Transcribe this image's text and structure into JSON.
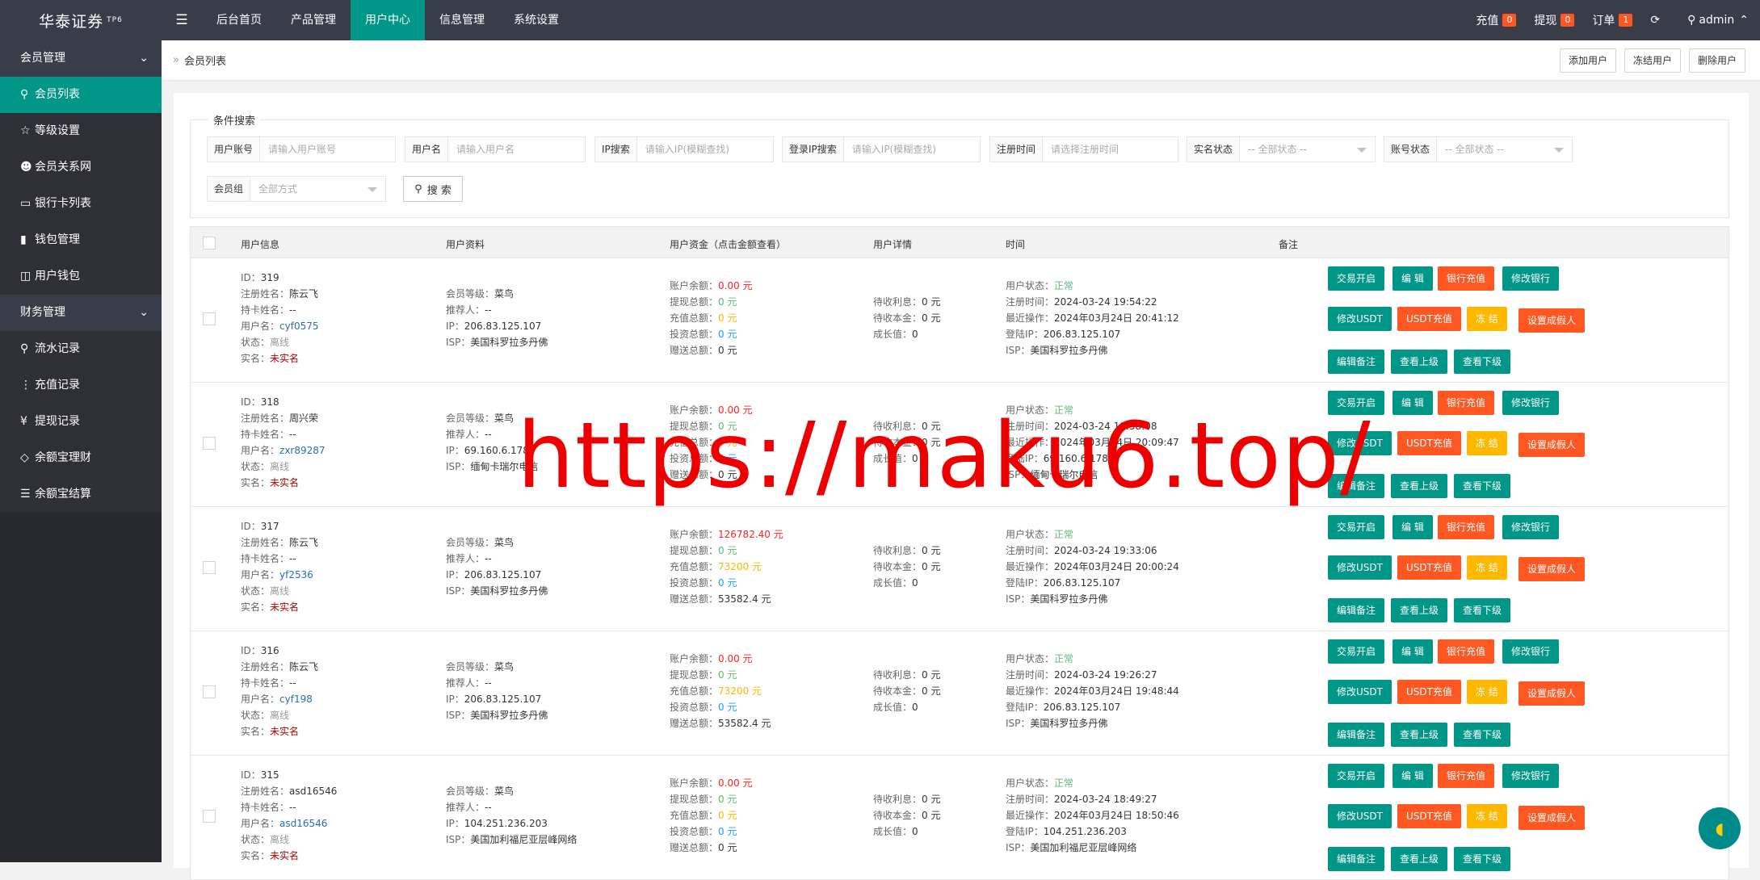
{
  "app": {
    "logo": "华泰证券",
    "logo_sup": "TP6"
  },
  "topnav": [
    "后台首页",
    "产品管理",
    "用户中心",
    "信息管理",
    "系统设置"
  ],
  "topright": {
    "recharge": "充值",
    "recharge_count": "0",
    "withdraw": "提现",
    "withdraw_count": "0",
    "orders": "订单",
    "orders_count": "1",
    "user": "admin"
  },
  "sidebar": {
    "group1": "会员管理",
    "items1": [
      {
        "label": "会员列表",
        "icon": "user-icon"
      },
      {
        "label": "等级设置",
        "icon": "star-icon"
      },
      {
        "label": "会员关系网",
        "icon": "users-icon"
      },
      {
        "label": "银行卡列表",
        "icon": "card-icon"
      },
      {
        "label": "钱包管理",
        "icon": "wallet-icon"
      },
      {
        "label": "用户钱包",
        "icon": "book-icon"
      }
    ],
    "group2": "财务管理",
    "items2": [
      {
        "label": "流水记录",
        "icon": "user-icon"
      },
      {
        "label": "充值记录",
        "icon": "dots-icon"
      },
      {
        "label": "提现记录",
        "icon": "yen-icon"
      },
      {
        "label": "余额宝理财",
        "icon": "diamond-icon"
      },
      {
        "label": "余额宝结算",
        "icon": "list-icon"
      }
    ]
  },
  "breadcrumb": "会员列表",
  "header_buttons": [
    "添加用户",
    "冻结用户",
    "删除用户"
  ],
  "filter": {
    "legend": "条件搜索",
    "fields": [
      {
        "label": "用户账号",
        "placeholder": "请输入用户账号"
      },
      {
        "label": "用户名",
        "placeholder": "请输入用户名"
      },
      {
        "label": "IP搜索",
        "placeholder": "请输入IP(模糊查找)"
      },
      {
        "label": "登录IP搜索",
        "placeholder": "请输入IP(模糊查找)"
      },
      {
        "label": "注册时间",
        "placeholder": "请选择注册时间"
      },
      {
        "label": "实名状态",
        "placeholder": "-- 全部状态 --"
      },
      {
        "label": "账号状态",
        "placeholder": "-- 全部状态 --"
      },
      {
        "label": "会员组",
        "placeholder": "全部方式"
      }
    ],
    "search": "搜 索"
  },
  "table": {
    "headers": [
      "用户信息",
      "用户资料",
      "用户资金（点击金额查看）",
      "用户详情",
      "时间",
      "备注"
    ]
  },
  "labels": {
    "id": "ID：",
    "realname": "注册姓名：",
    "cardholder": "持卡姓名：",
    "username": "用户名：",
    "status": "状态：",
    "verify": "实名：",
    "level": "会员等级：",
    "referrer": "推荐人：",
    "ip": "IP：",
    "isp": "ISP：",
    "balance": "账户余额：",
    "withdraw_total": "提现总额：",
    "recharge_total": "充值总额：",
    "invest_total": "投资总额：",
    "gift_total": "赠送总额：",
    "interest": "待收利息：",
    "principal": "待收本金：",
    "growth": "成长值：",
    "ustatus": "用户状态：",
    "regtime": "注册时间：",
    "lastop": "最近操作：",
    "loginip": "登陆IP：",
    "isp2": "ISP："
  },
  "buttons": [
    "交易开启",
    "编 辑",
    "银行充值",
    "修改银行",
    "修改USDT",
    "USDT充值",
    "冻 结",
    "设置成假人",
    "编辑备注",
    "查看上级",
    "查看下级"
  ],
  "rows": [
    {
      "id": "319",
      "realname": "陈云飞",
      "cardholder": "--",
      "username": "cyf0575",
      "status": "离线",
      "verify": "未实名",
      "level": "菜鸟",
      "referrer": "--",
      "ip": "206.83.125.107",
      "isp": "美国科罗拉多丹佛",
      "balance": "0.00 元",
      "withdraw": "0 元",
      "recharge": "0 元",
      "invest": "0 元",
      "gift": "0 元",
      "interest": "0 元",
      "principal": "0 元",
      "growth": "0",
      "ustatus": "正常",
      "regtime": "2024-03-24 19:54:22",
      "lastop": "2024年03月24日 20:41:12",
      "loginip": "206.83.125.107",
      "isp2": "美国科罗拉多丹佛"
    },
    {
      "id": "318",
      "realname": "周兴荣",
      "cardholder": "--",
      "username": "zxr89287",
      "status": "离线",
      "verify": "未实名",
      "level": "菜鸟",
      "referrer": "--",
      "ip": "69.160.6.178",
      "isp": "缅甸卡瑞尔电信",
      "balance": "0.00 元",
      "withdraw": "0 元",
      "recharge": "0 元",
      "invest": "0 元",
      "gift": "0 元",
      "interest": "0 元",
      "principal": "0 元",
      "growth": "0",
      "ustatus": "正常",
      "regtime": "2024-03-24 19:38:08",
      "lastop": "2024年03月24日 20:09:47",
      "loginip": "69.160.6.178",
      "isp2": "缅甸卡瑞尔电信"
    },
    {
      "id": "317",
      "realname": "陈云飞",
      "cardholder": "--",
      "username": "yf2536",
      "status": "离线",
      "verify": "未实名",
      "level": "菜鸟",
      "referrer": "--",
      "ip": "206.83.125.107",
      "isp": "美国科罗拉多丹佛",
      "balance": "126782.40 元",
      "withdraw": "0 元",
      "recharge": "73200 元",
      "invest": "0 元",
      "gift": "53582.4 元",
      "interest": "0 元",
      "principal": "0 元",
      "growth": "0",
      "ustatus": "正常",
      "regtime": "2024-03-24 19:33:06",
      "lastop": "2024年03月24日 20:00:24",
      "loginip": "206.83.125.107",
      "isp2": "美国科罗拉多丹佛"
    },
    {
      "id": "316",
      "realname": "陈云飞",
      "cardholder": "--",
      "username": "cyf198",
      "status": "离线",
      "verify": "未实名",
      "level": "菜鸟",
      "referrer": "--",
      "ip": "206.83.125.107",
      "isp": "美国科罗拉多丹佛",
      "balance": "0.00 元",
      "withdraw": "0 元",
      "recharge": "73200 元",
      "invest": "0 元",
      "gift": "53582.4 元",
      "interest": "0 元",
      "principal": "0 元",
      "growth": "0",
      "ustatus": "正常",
      "regtime": "2024-03-24 19:26:27",
      "lastop": "2024年03月24日 19:48:44",
      "loginip": "206.83.125.107",
      "isp2": "美国科罗拉多丹佛"
    },
    {
      "id": "315",
      "realname": "asd16546",
      "cardholder": "--",
      "username": "asd16546",
      "status": "离线",
      "verify": "未实名",
      "level": "菜鸟",
      "referrer": "--",
      "ip": "104.251.236.203",
      "isp": "美国加利福尼亚层峰网络",
      "balance": "0.00 元",
      "withdraw": "0 元",
      "recharge": "0 元",
      "invest": "0 元",
      "gift": "0 元",
      "interest": "0 元",
      "principal": "0 元",
      "growth": "0",
      "ustatus": "正常",
      "regtime": "2024-03-24 18:49:27",
      "lastop": "2024年03月24日 18:50:46",
      "loginip": "104.251.236.203",
      "isp2": "美国加利福尼亚层峰网络"
    }
  ],
  "watermark": "https://maku6.top/",
  "colors": {
    "topbar": "#393d49",
    "accent": "#009688",
    "danger": "#ff5722",
    "warn": "#ffb800"
  }
}
